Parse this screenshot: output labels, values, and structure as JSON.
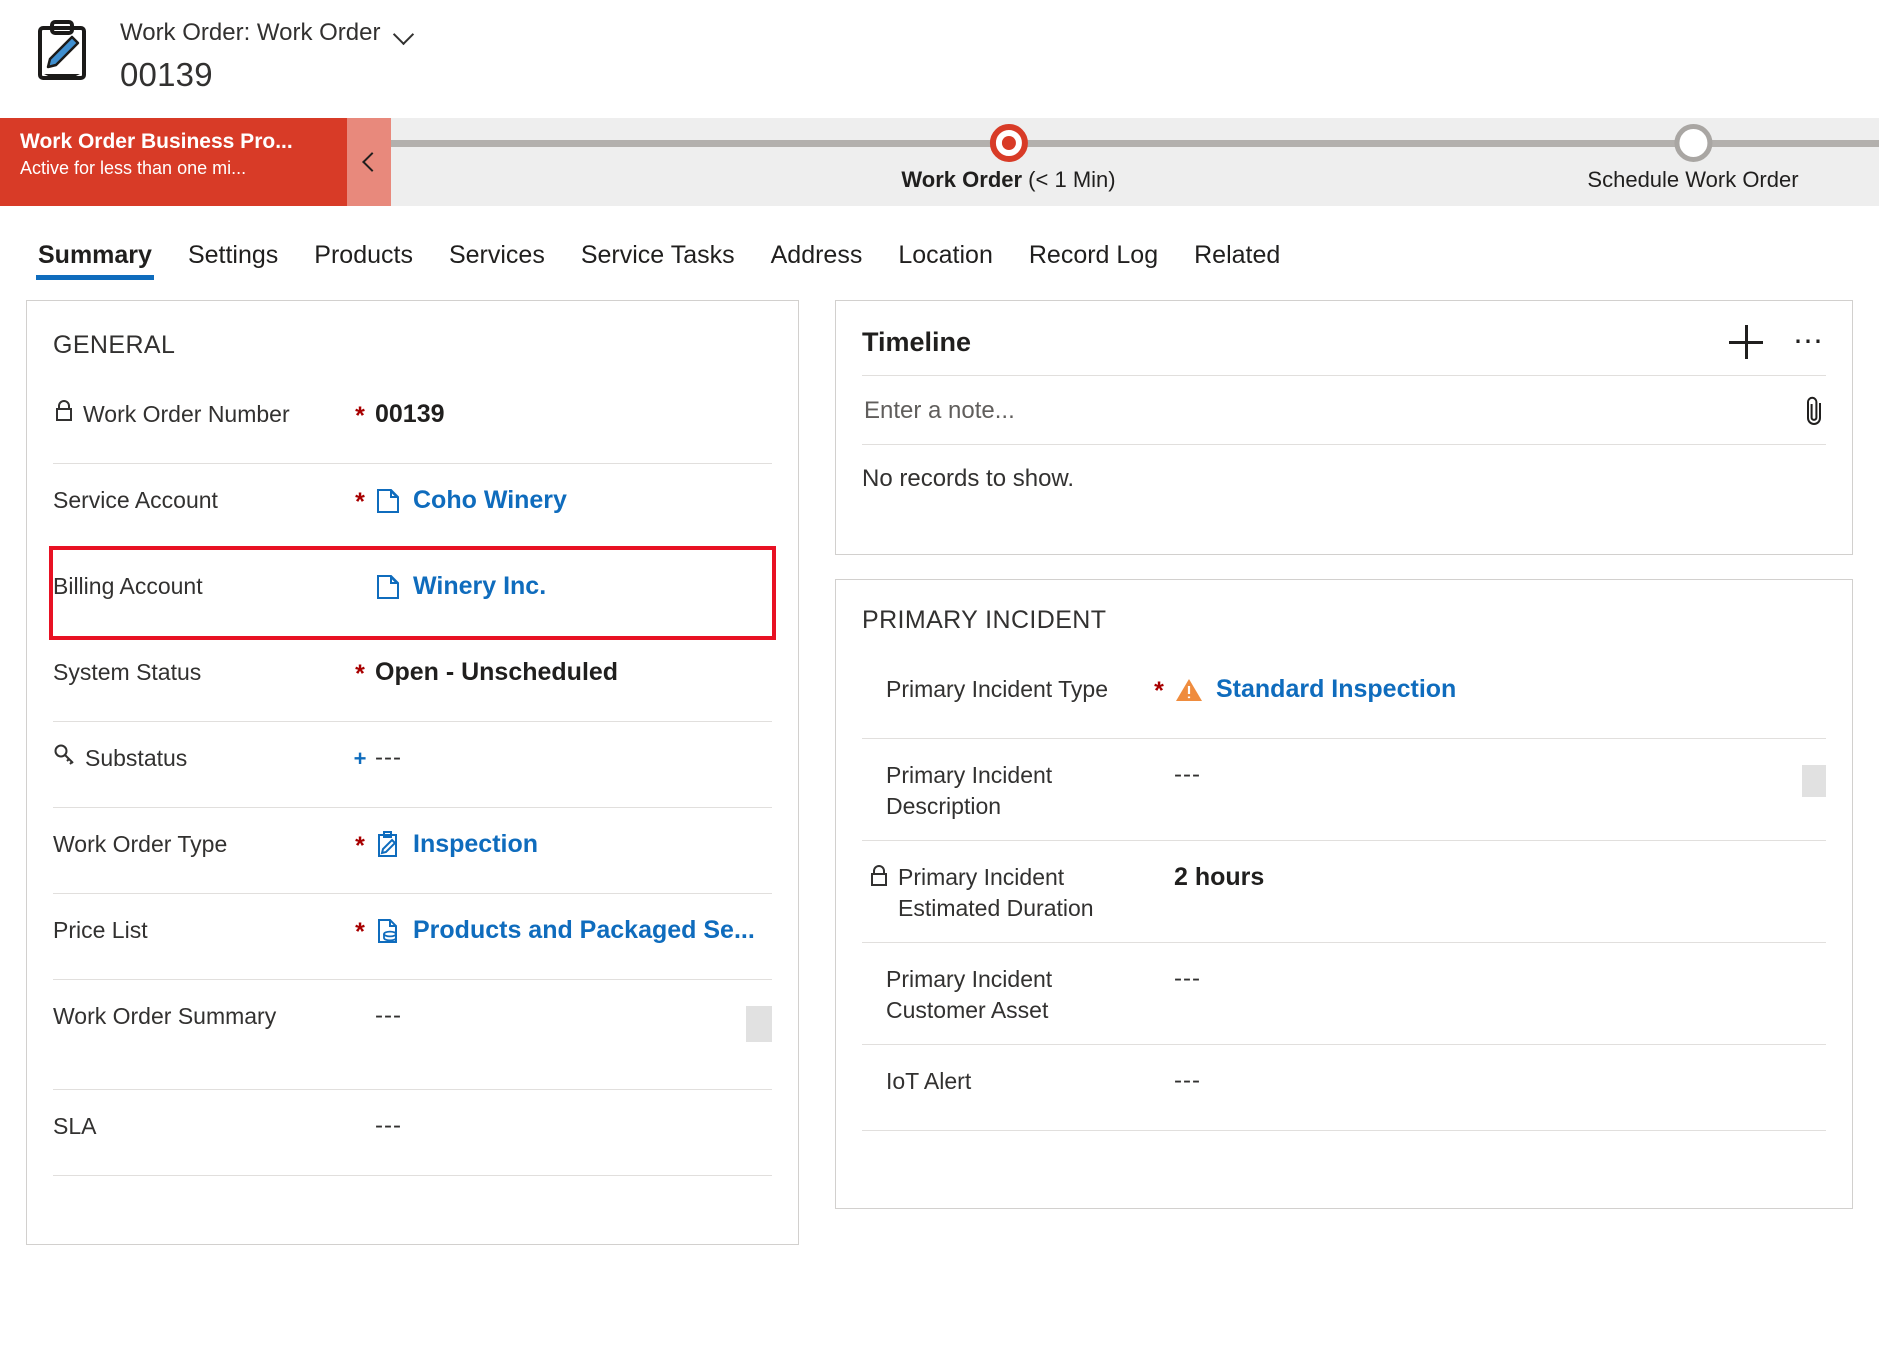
{
  "header": {
    "record_icon": "clipboard-pencil-icon",
    "breadcrumb": "Work Order: Work Order",
    "chevron": "chevron-down-icon",
    "title": "00139"
  },
  "business_process": {
    "name": "Work Order Business Pro...",
    "status": "Active for less than one mi...",
    "collapse_icon": "chevron-left-icon",
    "accent_color": "#d83b27",
    "stages": [
      {
        "label": "Work Order",
        "time": "(< 1 Min)",
        "state": "active"
      },
      {
        "label": "Schedule Work Order",
        "time": "",
        "state": "inactive"
      }
    ]
  },
  "tabs": [
    {
      "label": "Summary",
      "active": true
    },
    {
      "label": "Settings",
      "active": false
    },
    {
      "label": "Products",
      "active": false
    },
    {
      "label": "Services",
      "active": false
    },
    {
      "label": "Service Tasks",
      "active": false
    },
    {
      "label": "Address",
      "active": false
    },
    {
      "label": "Location",
      "active": false
    },
    {
      "label": "Record Log",
      "active": false
    },
    {
      "label": "Related",
      "active": false
    }
  ],
  "general": {
    "title": "GENERAL",
    "fields": [
      {
        "label": "Work Order Number",
        "required": "*",
        "value": "00139",
        "value_type": "text-bold",
        "lock": true
      },
      {
        "label": "Service Account",
        "required": "*",
        "value": "Coho Winery",
        "value_type": "link",
        "icon": "account-record-icon"
      },
      {
        "label": "Billing Account",
        "required": "",
        "value": "Winery Inc.",
        "value_type": "link",
        "icon": "account-record-icon",
        "highlighted": true
      },
      {
        "label": "System Status",
        "required": "*",
        "value": "Open - Unscheduled",
        "value_type": "text-bold"
      },
      {
        "label": "Substatus",
        "required": "+",
        "value": "---",
        "value_type": "empty",
        "key_icon": true
      },
      {
        "label": "Work Order Type",
        "required": "*",
        "value": "Inspection",
        "value_type": "link",
        "icon": "work-order-type-icon"
      },
      {
        "label": "Price List",
        "required": "*",
        "value": "Products and Packaged Se...",
        "value_type": "link",
        "icon": "price-list-icon"
      },
      {
        "label": "Work Order Summary",
        "required": "",
        "value": "---",
        "value_type": "empty",
        "multiline": true
      },
      {
        "label": "SLA",
        "required": "",
        "value": "---",
        "value_type": "empty"
      }
    ]
  },
  "timeline": {
    "title": "Timeline",
    "add_icon": "plus-icon",
    "more_icon": "more-options-icon",
    "note_placeholder": "Enter a note...",
    "note_value": "",
    "attach_icon": "paperclip-icon",
    "empty_message": "No records to show."
  },
  "primary_incident": {
    "title": "PRIMARY INCIDENT",
    "fields": [
      {
        "label": "Primary Incident Type",
        "required": "*",
        "value": "Standard Inspection",
        "value_type": "link",
        "icon": "incident-type-warning-icon"
      },
      {
        "label": "Primary Incident Description",
        "required": "",
        "value": "---",
        "value_type": "empty",
        "multiline": true
      },
      {
        "label": "Primary Incident Estimated Duration",
        "required": "",
        "value": "2 hours",
        "value_type": "text-bold",
        "lock": true
      },
      {
        "label": "Primary Incident Customer Asset",
        "required": "",
        "value": "---",
        "value_type": "empty"
      },
      {
        "label": "IoT Alert",
        "required": "",
        "value": "---",
        "value_type": "empty"
      }
    ]
  },
  "colors": {
    "brand_blue": "#0f6cbd",
    "process_red": "#d83b27",
    "required_red": "#a80000",
    "highlight_red": "#e81123",
    "warning_orange": "#ef8c3e"
  }
}
